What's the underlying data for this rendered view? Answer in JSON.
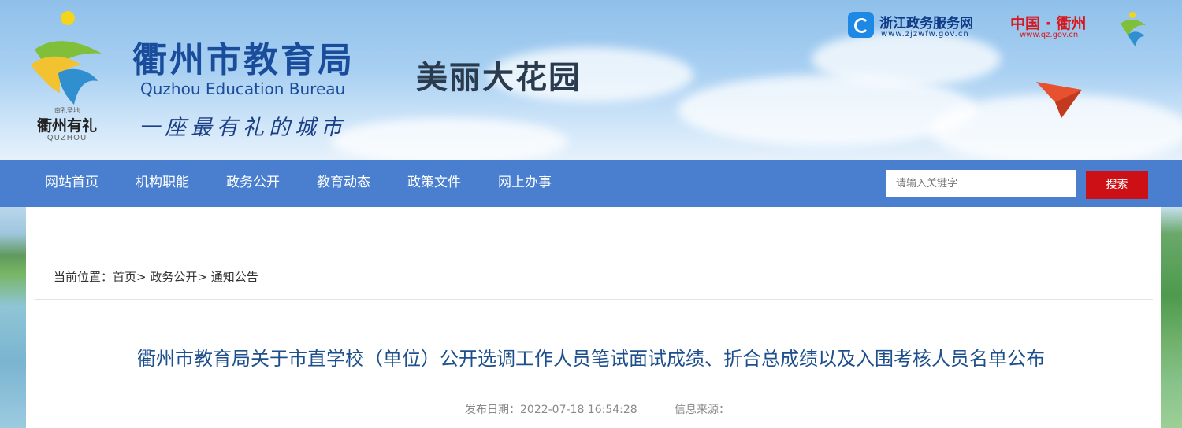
{
  "header": {
    "logo_small_text": "南孔圣地",
    "logo_caption": "衢州有礼",
    "logo_quzhou": "QUZHOU",
    "site_title": "衢州市教育局",
    "site_subtitle": "Quzhou Education Bureau",
    "slogan": "一座最有礼的城市",
    "beauty_text": "美丽大花园",
    "zj_link": {
      "name": "浙江政务服务网",
      "url": "www.zjzwfw.gov.cn"
    },
    "qz_link": {
      "name": "中国 · 衢州",
      "url": "www.qz.gov.cn"
    }
  },
  "nav": {
    "items": [
      "网站首页",
      "机构职能",
      "政务公开",
      "教育动态",
      "政策文件",
      "网上办事"
    ]
  },
  "search": {
    "placeholder": "请输入关键字",
    "button_label": "搜索"
  },
  "breadcrumb": {
    "prefix": "当前位置：",
    "items": [
      "首页>",
      "政务公开>",
      "通知公告"
    ]
  },
  "article": {
    "title": "衢州市教育局关于市直学校（单位）公开选调工作人员笔试面试成绩、折合总成绩以及入围考核人员名单公布",
    "publish_label": "发布日期：",
    "publish_date": "2022-07-18 16:54:28",
    "source_label": "信息来源："
  },
  "colors": {
    "nav_bg": "#4a7fd0",
    "search_button": "#cc1016",
    "title_blue": "#1d4f8c",
    "brand_red": "#d7181f"
  },
  "icons": [
    "quzhou-emblem-icon",
    "zjzwfw-logo-icon",
    "paper-plane-icon"
  ]
}
